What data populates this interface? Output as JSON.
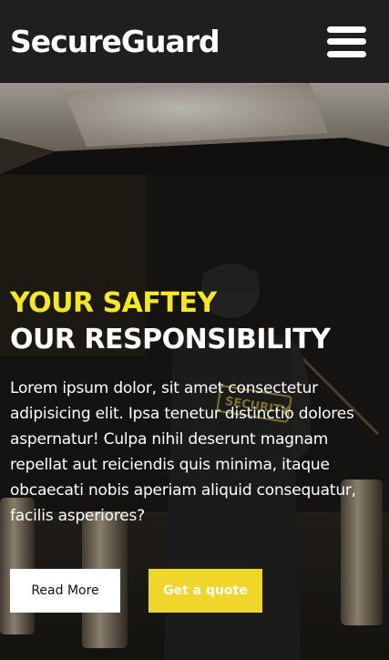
{
  "header": {
    "brand": "SecureGuard"
  },
  "hero": {
    "headline_accent": "YOUR SAFTEY",
    "headline": "OUR RESPONSIBILITY",
    "body": "Lorem ipsum dolor, sit amet consectetur adipisicing elit. Ipsa tenetur distinctio dolores aspernatur! Culpa nihil deserunt magnam repellat aut reiciendis quis minima, itaque obcaecati nobis aperiam aliquid consequatur, facilis asperiores?",
    "badge_text": "SECURITY",
    "primary_button": "Read More",
    "secondary_button": "Get a quote"
  },
  "colors": {
    "accent": "#f7ea1c",
    "button_accent": "#f1d62a",
    "header_bg": "#1f1f1f"
  }
}
